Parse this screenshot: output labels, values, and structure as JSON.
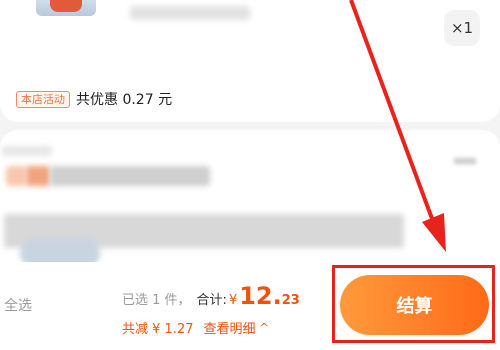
{
  "cart_item": {
    "quantity_label": "×1",
    "promo_tag": "本店活动",
    "promo_text": "共优惠 0.27 元"
  },
  "footer": {
    "select_all": "全选",
    "selected_count": "已选 1 件，",
    "total_label": "合计:",
    "currency": "¥",
    "amount_integer": "12.",
    "amount_decimal": "23",
    "discount_text": "共减 ¥ 1.27",
    "detail_link": "查看明细",
    "checkout_label": "结算"
  },
  "colors": {
    "accent": "#f0520e",
    "highlight": "#e8231b",
    "button_gradient_start": "#ff9a3c",
    "button_gradient_end": "#ff6a17"
  },
  "icons": {
    "detail_chevron": "chevron-up-icon",
    "annotation_arrow": "arrow-icon"
  }
}
